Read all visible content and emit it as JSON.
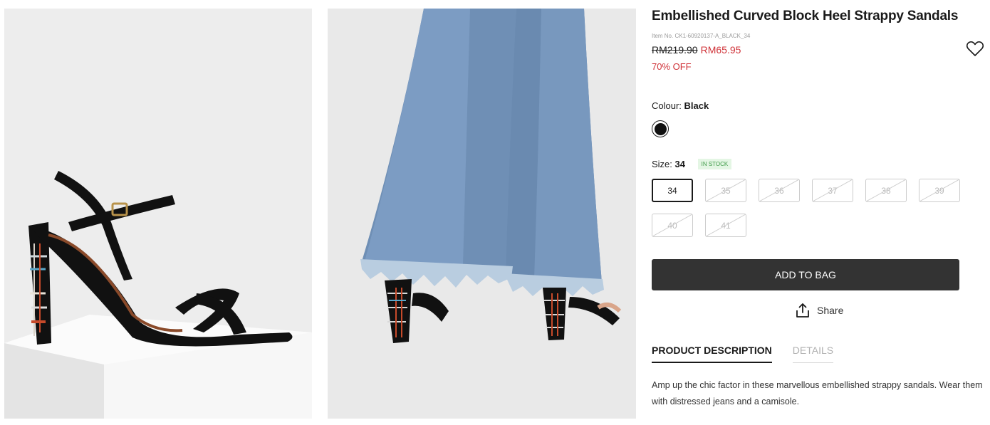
{
  "product": {
    "title": "Embellished Curved Block Heel Strappy Sandals",
    "item_no": "Item No. CK1-60920137-A_BLACK_34",
    "price_original": "RM219.90",
    "price_sale": "RM65.95",
    "discount": "70% OFF"
  },
  "colour": {
    "label": "Colour:",
    "selected": "Black",
    "swatch_color": "#111111"
  },
  "size": {
    "label": "Size:",
    "selected": "34",
    "stock_badge": "IN STOCK",
    "options": [
      {
        "label": "34",
        "available": true
      },
      {
        "label": "35",
        "available": false
      },
      {
        "label": "36",
        "available": false
      },
      {
        "label": "37",
        "available": false
      },
      {
        "label": "38",
        "available": false
      },
      {
        "label": "39",
        "available": false
      },
      {
        "label": "40",
        "available": false
      },
      {
        "label": "41",
        "available": false
      }
    ]
  },
  "actions": {
    "add_to_bag": "ADD TO BAG",
    "share": "Share"
  },
  "tabs": [
    {
      "label": "PRODUCT DESCRIPTION",
      "active": true
    },
    {
      "label": "DETAILS",
      "active": false
    }
  ],
  "description": "Amp up the chic factor in these marvellous embellished strappy sandals. Wear them with distressed jeans and a camisole.",
  "icons": {
    "wishlist": "heart-icon",
    "share": "share-icon"
  },
  "colors": {
    "sale": "#d0343a",
    "button": "#333333",
    "stock": "#3d9a47"
  }
}
